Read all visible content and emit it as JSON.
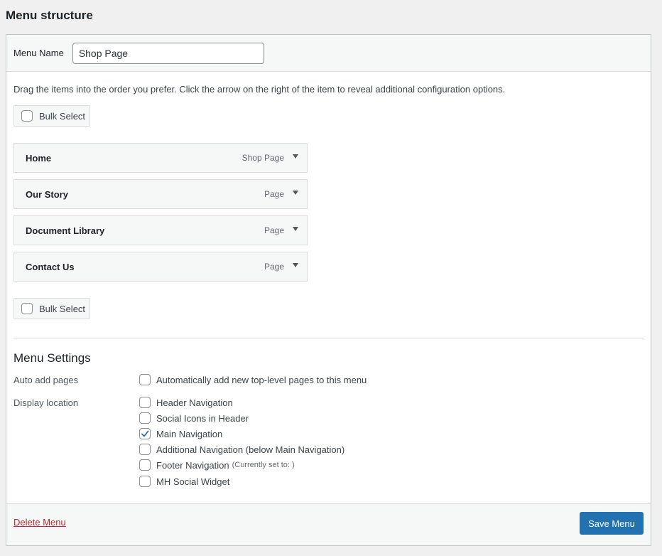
{
  "section_title": "Menu structure",
  "menu_name": {
    "label": "Menu Name",
    "value": "Shop Page"
  },
  "instructions": "Drag the items into the order you prefer. Click the arrow on the right of the item to reveal additional configuration options.",
  "bulk_select_label": "Bulk Select",
  "menu_items": [
    {
      "title": "Home",
      "type": "Shop Page"
    },
    {
      "title": "Our Story",
      "type": "Page"
    },
    {
      "title": "Document Library",
      "type": "Page"
    },
    {
      "title": "Contact Us",
      "type": "Page"
    }
  ],
  "settings": {
    "title": "Menu Settings",
    "auto_add_label": "Auto add pages",
    "auto_add_option": "Automatically add new top-level pages to this menu",
    "display_location_label": "Display location",
    "locations": [
      {
        "label": "Header Navigation",
        "checked": false,
        "note": ""
      },
      {
        "label": "Social Icons in Header",
        "checked": false,
        "note": ""
      },
      {
        "label": "Main Navigation",
        "checked": true,
        "note": ""
      },
      {
        "label": "Additional Navigation (below Main Navigation)",
        "checked": false,
        "note": ""
      },
      {
        "label": "Footer Navigation",
        "checked": false,
        "note": "(Currently set to: )"
      },
      {
        "label": "MH Social Widget",
        "checked": false,
        "note": ""
      }
    ]
  },
  "footer": {
    "delete_label": "Delete Menu",
    "save_label": "Save Menu"
  },
  "colors": {
    "accent": "#2271b1",
    "delete": "#b32d2e",
    "check": "#2271b1"
  }
}
